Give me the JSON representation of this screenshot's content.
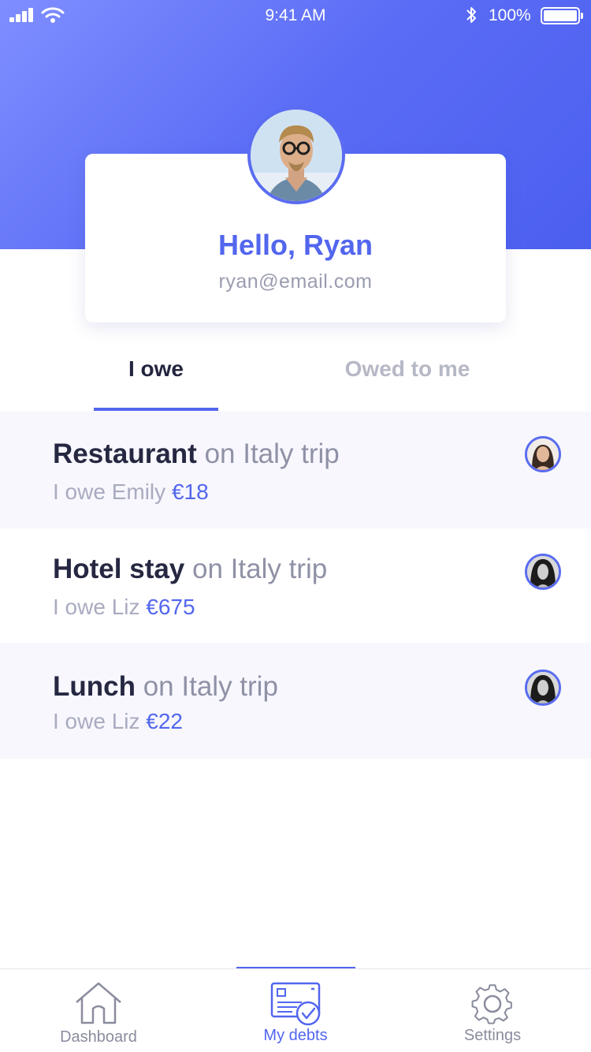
{
  "status_bar": {
    "time": "9:41 AM",
    "battery": "100%"
  },
  "profile": {
    "greeting": "Hello, Ryan",
    "email": "ryan@email.com"
  },
  "tabs": [
    {
      "label": "I owe",
      "active": true
    },
    {
      "label": "Owed to me",
      "active": false
    }
  ],
  "debts": [
    {
      "item": "Restaurant",
      "context": "on Italy trip",
      "prefix": "I owe Emily",
      "amount": "€18"
    },
    {
      "item": "Hotel stay",
      "context": "on Italy trip",
      "prefix": "I owe Liz",
      "amount": "€675"
    },
    {
      "item": "Lunch",
      "context": "on Italy trip",
      "prefix": "I owe Liz",
      "amount": "€22"
    }
  ],
  "tabbar": [
    {
      "label": "Dashboard",
      "icon": "home-icon"
    },
    {
      "label": "My debts",
      "icon": "debts-icon"
    },
    {
      "label": "Settings",
      "icon": "gear-icon"
    }
  ],
  "colors": {
    "accent": "#5266ee",
    "header_start": "#7f8eff",
    "header_end": "#4b5ff0"
  }
}
